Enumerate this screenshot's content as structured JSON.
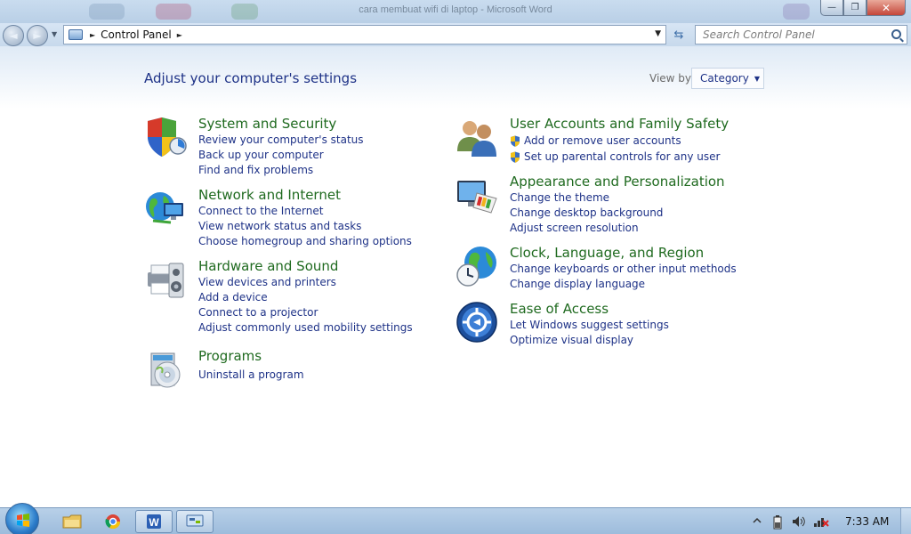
{
  "window": {
    "title": "cara membuat wifi di laptop - Microsoft Word",
    "minimize_label": "—",
    "restore_label": "❐",
    "close_label": "✕"
  },
  "navigation": {
    "back_label": "◄",
    "forward_label": "►",
    "address_path": "Control Panel",
    "refresh_label": "⇆",
    "search_placeholder": "Search Control Panel"
  },
  "header": {
    "title": "Adjust your computer's settings",
    "view_by_label": "View by:",
    "view_by_value": "Category"
  },
  "categories_left": [
    {
      "title": "System and Security",
      "icon": "shield-chart-icon",
      "links": [
        "Review your computer's status",
        "Back up your computer",
        "Find and fix problems"
      ]
    },
    {
      "title": "Network and Internet",
      "icon": "globe-network-icon",
      "links": [
        "Connect to the Internet",
        "View network status and tasks",
        "Choose homegroup and sharing options"
      ]
    },
    {
      "title": "Hardware and Sound",
      "icon": "printer-speaker-icon",
      "links": [
        "View devices and printers",
        "Add a device",
        "Connect to a projector",
        "Adjust commonly used mobility settings"
      ]
    },
    {
      "title": "Programs",
      "icon": "disc-box-icon",
      "links": [
        "Uninstall a program"
      ]
    }
  ],
  "categories_right": [
    {
      "title": "User Accounts and Family Safety",
      "icon": "users-icon",
      "links": [
        "Add or remove user accounts",
        "Set up parental controls for any user"
      ]
    },
    {
      "title": "Appearance and Personalization",
      "icon": "monitor-palette-icon",
      "links": [
        "Change the theme",
        "Change desktop background",
        "Adjust screen resolution"
      ]
    },
    {
      "title": "Clock, Language, and Region",
      "icon": "globe-clock-icon",
      "links": [
        "Change keyboards or other input methods",
        "Change display language"
      ]
    },
    {
      "title": "Ease of Access",
      "icon": "accessibility-icon",
      "links": [
        "Let Windows suggest settings",
        "Optimize visual display"
      ]
    }
  ],
  "taskbar": {
    "clock": "7:33 AM",
    "items": [
      "explorer-icon",
      "chrome-icon",
      "word-icon",
      "control-panel-icon"
    ]
  },
  "colors": {
    "link": "#1e3287",
    "category_title": "#1f6a1f",
    "accent": "#3d6ea8"
  }
}
